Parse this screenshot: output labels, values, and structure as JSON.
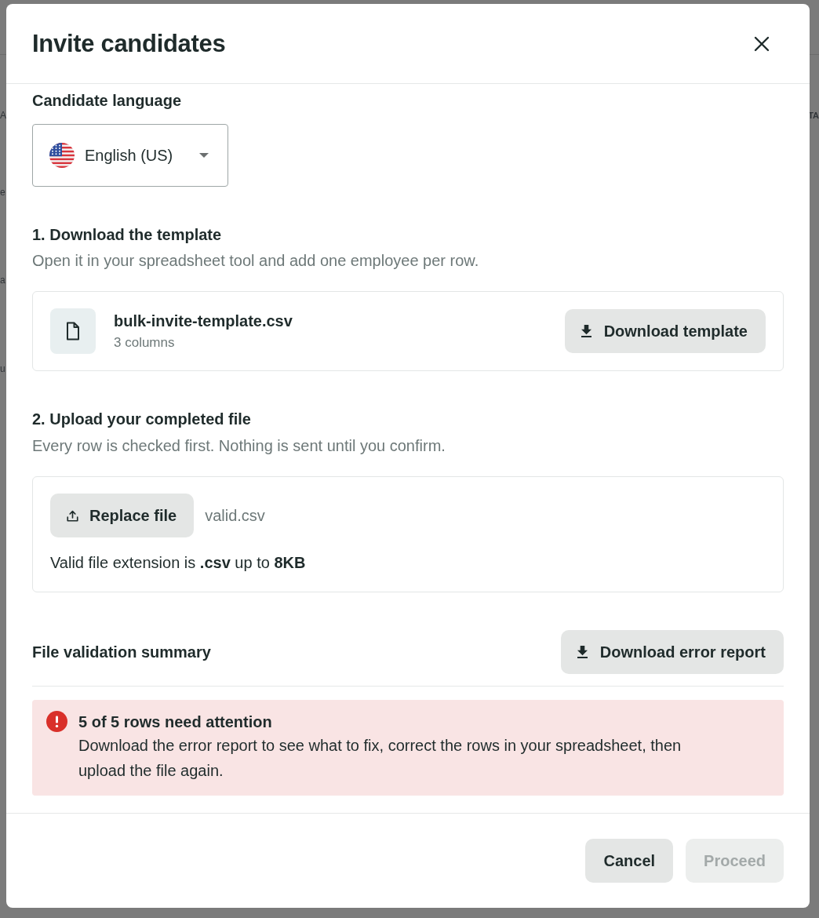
{
  "backdrop": {
    "left_fragments": [
      "A",
      "e",
      "a",
      "u"
    ],
    "right_fragments": [
      "TA"
    ]
  },
  "dialog": {
    "title": "Invite candidates"
  },
  "language": {
    "label": "Candidate language",
    "value": "English (US)"
  },
  "template_step": {
    "title": "1. Download the template",
    "description": "Open it in your spreadsheet tool and add one employee per row.",
    "file_name": "bulk-invite-template.csv",
    "file_meta": "3 columns",
    "button": "Download template"
  },
  "upload_step": {
    "title": "2. Upload your completed file",
    "description": "Every row is checked first. Nothing is sent until you confirm.",
    "button": "Replace file",
    "file_name": "valid.csv",
    "hint": "Valid file extension is **.csv** up to **8KB**"
  },
  "validation": {
    "title": "File validation summary",
    "button": "Download error report",
    "alert": {
      "title": "5 of 5 rows need attention",
      "message": "Download the error report to see what to fix, correct the rows in your spreadsheet, then upload the file again."
    }
  },
  "footer": {
    "buttons": [
      {
        "label": "Cancel",
        "disabled": false
      },
      {
        "label": "Proceed",
        "disabled": true
      }
    ]
  }
}
